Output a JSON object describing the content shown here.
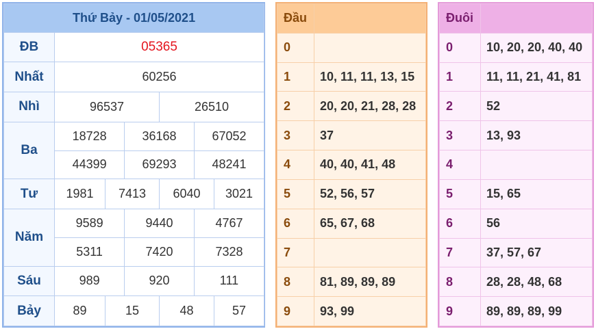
{
  "results": {
    "title": "Thứ Bảy - 01/05/2021",
    "db": {
      "label": "ĐB",
      "values": [
        "05365"
      ]
    },
    "nhat": {
      "label": "Nhất",
      "values": [
        "60256"
      ]
    },
    "nhi": {
      "label": "Nhì",
      "values": [
        "96537",
        "26510"
      ]
    },
    "ba": {
      "label": "Ba",
      "values": [
        "18728",
        "36168",
        "67052",
        "44399",
        "69293",
        "48241"
      ]
    },
    "tu": {
      "label": "Tư",
      "values": [
        "1981",
        "7413",
        "6040",
        "3021"
      ]
    },
    "nam": {
      "label": "Năm",
      "values": [
        "9589",
        "9440",
        "4767",
        "5311",
        "7420",
        "7328"
      ]
    },
    "sau": {
      "label": "Sáu",
      "values": [
        "989",
        "920",
        "111"
      ]
    },
    "bay": {
      "label": "Bảy",
      "values": [
        "89",
        "15",
        "48",
        "57"
      ]
    }
  },
  "heads": {
    "title": "Đầu",
    "rows": [
      {
        "digit": "0",
        "values": ""
      },
      {
        "digit": "1",
        "values": "10, 11, 11, 13, 15"
      },
      {
        "digit": "2",
        "values": "20, 20, 21, 28, 28"
      },
      {
        "digit": "3",
        "values": "37"
      },
      {
        "digit": "4",
        "values": "40, 40, 41, 48"
      },
      {
        "digit": "5",
        "values": "52, 56, 57"
      },
      {
        "digit": "6",
        "values": "65, 67, 68"
      },
      {
        "digit": "7",
        "values": ""
      },
      {
        "digit": "8",
        "values": "81, 89, 89, 89"
      },
      {
        "digit": "9",
        "values": "93, 99"
      }
    ]
  },
  "tails": {
    "title": "Đuôi",
    "rows": [
      {
        "digit": "0",
        "values": "10, 20, 20, 40, 40"
      },
      {
        "digit": "1",
        "values": "11, 11, 21, 41, 81"
      },
      {
        "digit": "2",
        "values": "52"
      },
      {
        "digit": "3",
        "values": "13, 93"
      },
      {
        "digit": "4",
        "values": ""
      },
      {
        "digit": "5",
        "values": "15, 65"
      },
      {
        "digit": "6",
        "values": "56"
      },
      {
        "digit": "7",
        "values": "37, 57, 67"
      },
      {
        "digit": "8",
        "values": "28, 28, 48, 68"
      },
      {
        "digit": "9",
        "values": "89, 89, 89, 99"
      }
    ]
  }
}
